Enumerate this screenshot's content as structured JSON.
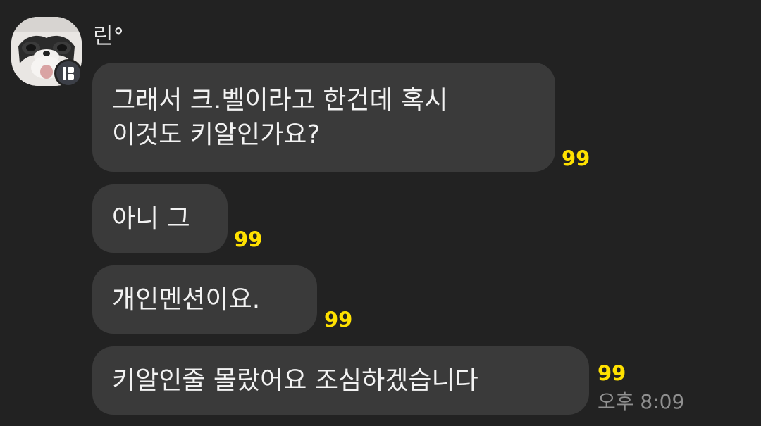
{
  "sender": {
    "name": "린°",
    "avatar_icon": "cat-photo-avatar",
    "badge_icon": "profile-badge-icon"
  },
  "messages": [
    {
      "text": "그래서 크.벨이라고 한건데 혹시\n이것도 키알인가요?",
      "unread": "99"
    },
    {
      "text": "아니 그",
      "unread": "99"
    },
    {
      "text": "개인멘션이요.",
      "unread": "99"
    },
    {
      "text": "키알인줄 몰랐어요 조심하겠습니다",
      "unread": "99",
      "time": "오후 8:09"
    }
  ],
  "colors": {
    "background": "#222222",
    "bubble": "#3a3a3a",
    "unread_count": "#ffe100",
    "timestamp": "#8f8f8f"
  }
}
